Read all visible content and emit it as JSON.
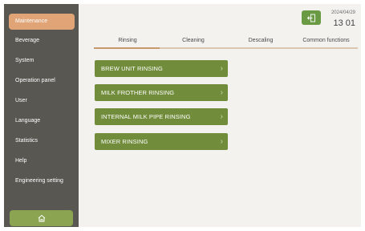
{
  "sidebar": {
    "items": [
      {
        "label": "Maintenance",
        "active": true
      },
      {
        "label": "Beverage"
      },
      {
        "label": "System"
      },
      {
        "label": "Operation panel"
      },
      {
        "label": "User"
      },
      {
        "label": "Language"
      },
      {
        "label": "Statistics"
      },
      {
        "label": "Help"
      },
      {
        "label": "Engineering setting"
      }
    ],
    "home_icon": "home-icon"
  },
  "header": {
    "back_icon": "back-icon",
    "date": "2024/04/29",
    "time": "13 01"
  },
  "tabs": [
    {
      "label": "Rinsing",
      "active": true
    },
    {
      "label": "Cleaning"
    },
    {
      "label": "Descaling"
    },
    {
      "label": "Common functions"
    }
  ],
  "actions": [
    {
      "label": "BREW UNIT RINSING"
    },
    {
      "label": "MILK FROTHER RINSING"
    },
    {
      "label": "INTERNAL MILK PIPE RINSING"
    },
    {
      "label": "MIXER RINSING"
    }
  ],
  "chevron": "›",
  "colors": {
    "sidebar_bg": "#585752",
    "active_menu": "#e0a477",
    "button_green": "#718c3b",
    "home_green": "#8ba451"
  }
}
